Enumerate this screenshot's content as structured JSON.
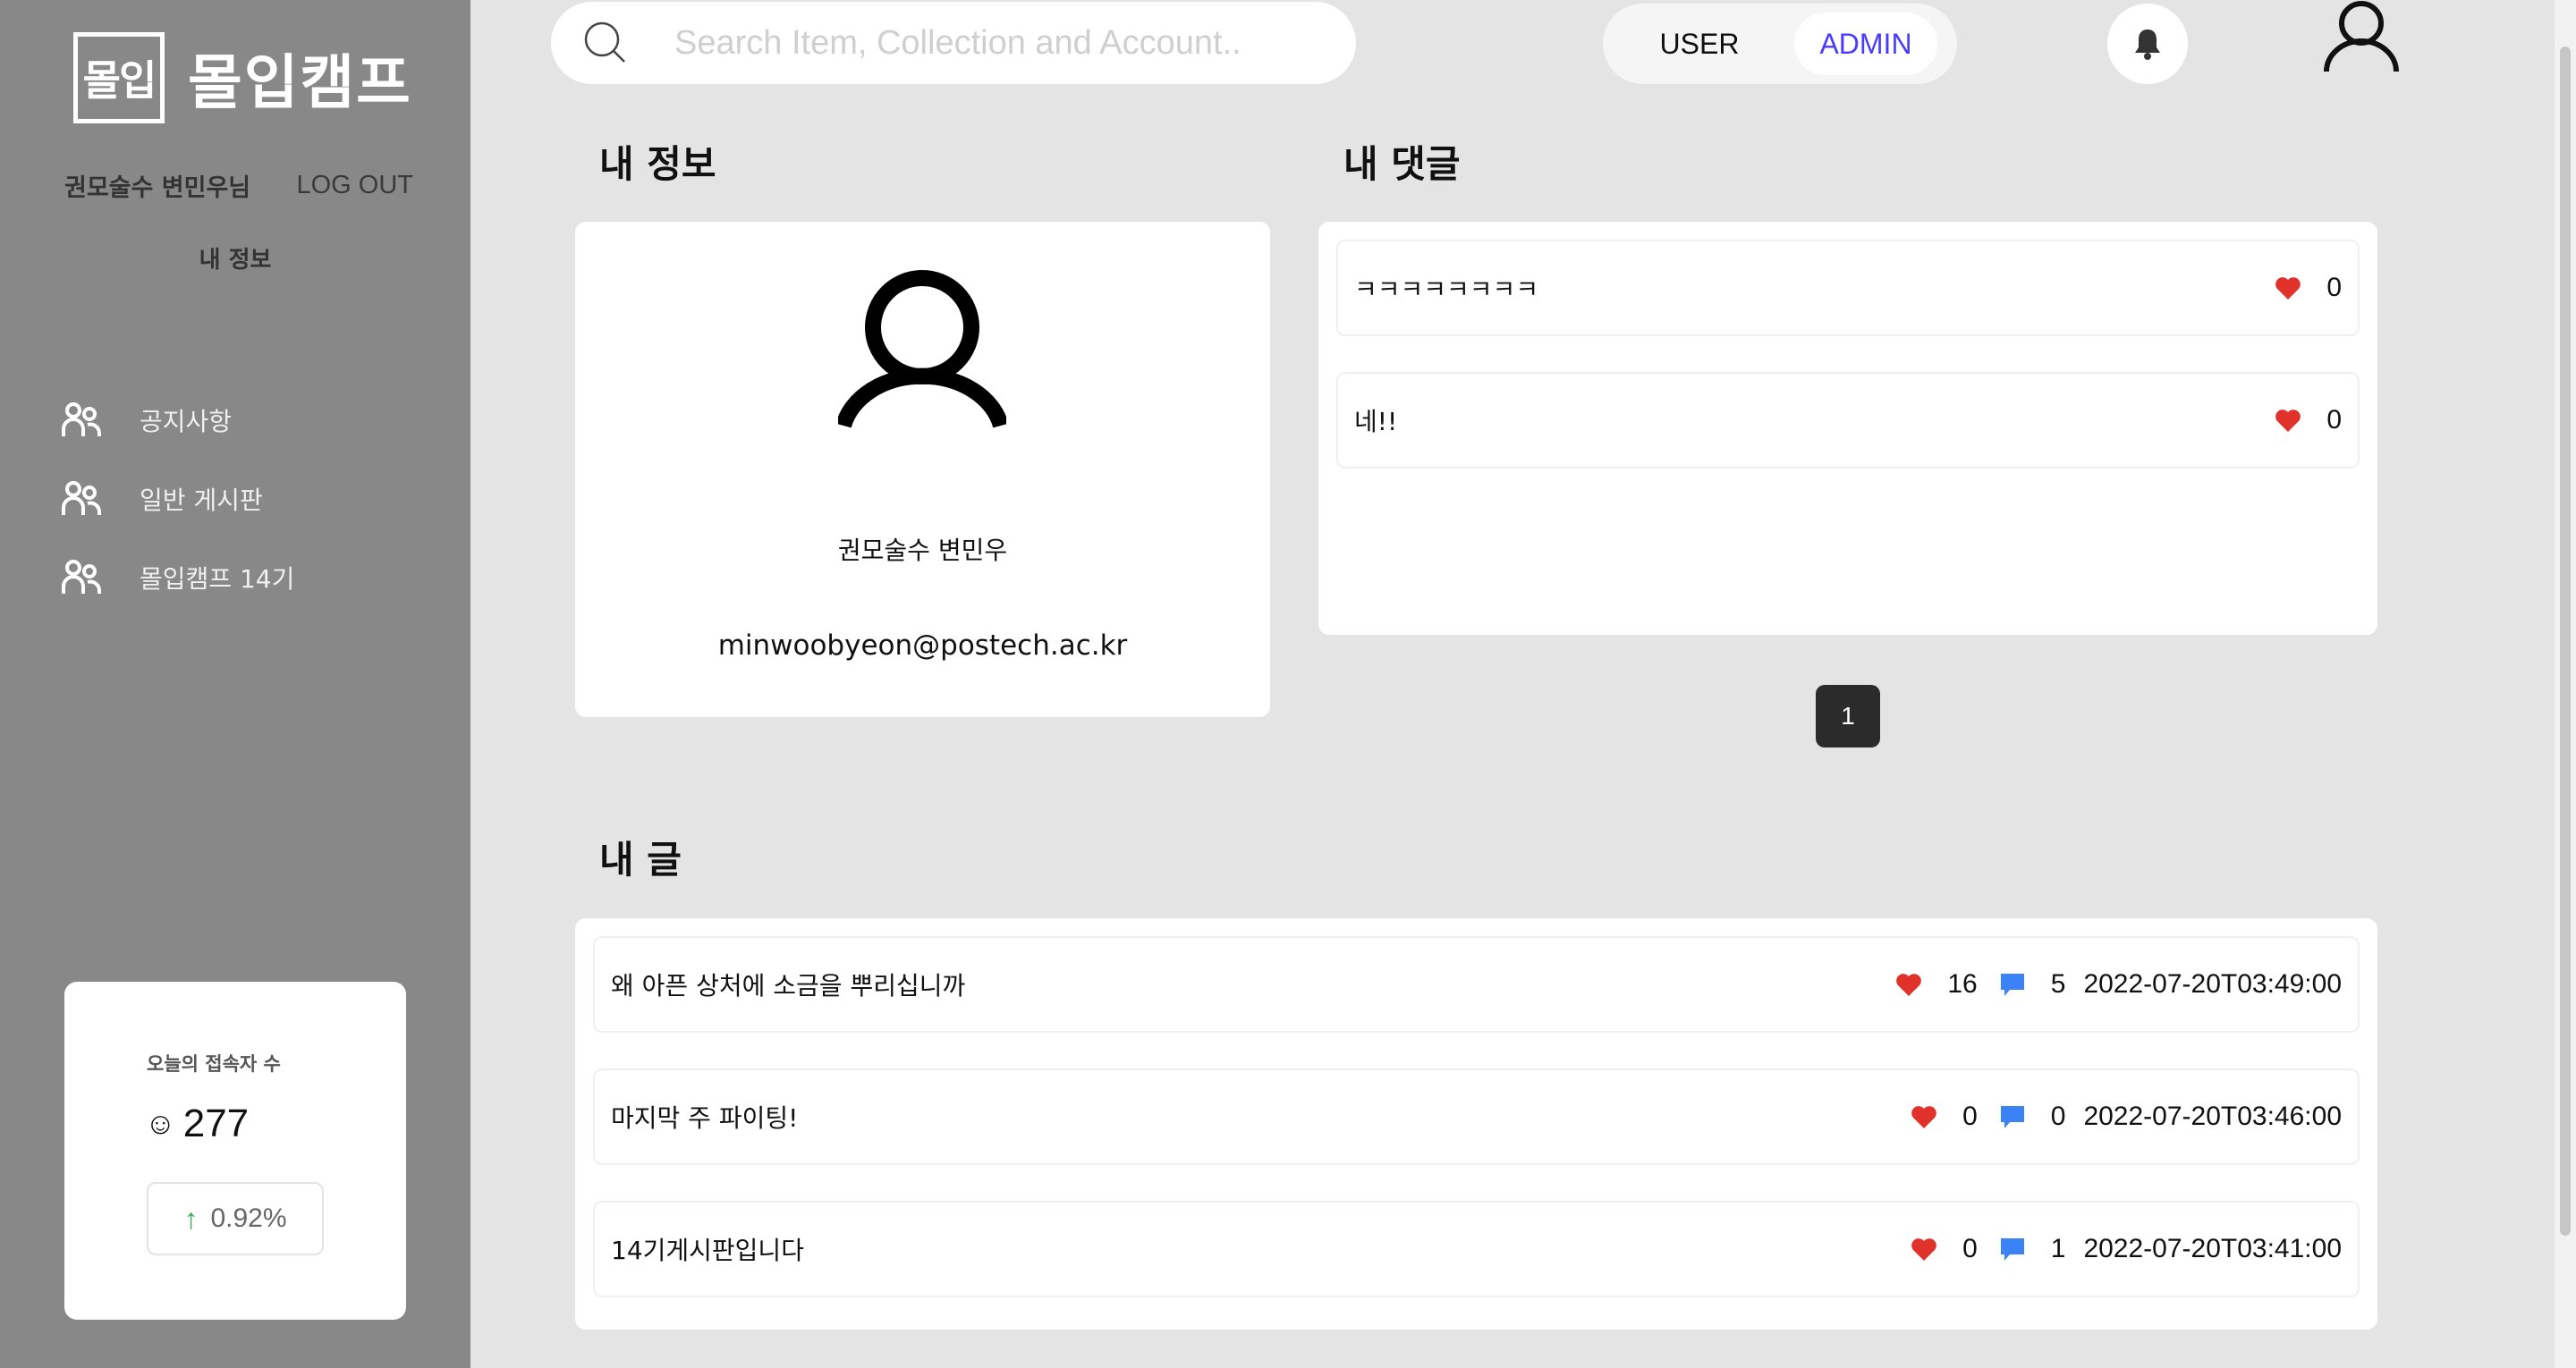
{
  "sidebar": {
    "logo_mark": "몰입",
    "logo_text": "몰입캠프",
    "user_name": "권모술수 변민우님",
    "logout_label": "LOG OUT",
    "myinfo_label": "내 정보",
    "nav": [
      {
        "label": "공지사항",
        "icon": "users-icon"
      },
      {
        "label": "일반 게시판",
        "icon": "users-icon"
      },
      {
        "label": "몰입캠프 14기",
        "icon": "users-icon"
      }
    ],
    "visitors": {
      "title": "오늘의 접속자 수",
      "icon": "☺",
      "count": "277",
      "change_icon": "↑",
      "change": "0.92%"
    }
  },
  "topbar": {
    "search_placeholder": "Search Item, Collection and Account..",
    "role_user": "USER",
    "role_admin": "ADMIN",
    "active_role": "ADMIN"
  },
  "profile": {
    "section_title": "내 정보",
    "name": "권모술수 변민우",
    "email": "minwoobyeon@postech.ac.kr"
  },
  "comments": {
    "section_title": "내 댓글",
    "items": [
      {
        "text": "ㅋㅋㅋㅋㅋㅋㅋㅋ",
        "likes": "0"
      },
      {
        "text": "네!!",
        "likes": "0"
      }
    ],
    "page": "1"
  },
  "posts": {
    "section_title": "내 글",
    "items": [
      {
        "title": "왜 아픈 상처에 소금을 뿌리십니까",
        "likes": "16",
        "comments": "5",
        "date": "2022-07-20T03:49:00"
      },
      {
        "title": "마지막 주 파이팅!",
        "likes": "0",
        "comments": "0",
        "date": "2022-07-20T03:46:00"
      },
      {
        "title": "14기게시판입니다",
        "likes": "0",
        "comments": "1",
        "date": "2022-07-20T03:41:00"
      }
    ]
  },
  "colors": {
    "sidebar_bg": "#888888",
    "page_bg": "#e4e4e4",
    "accent_admin": "#4b3bff",
    "heart": "#e0322a",
    "comment_icon": "#3b82f6",
    "trend_up": "#3cae5a"
  }
}
